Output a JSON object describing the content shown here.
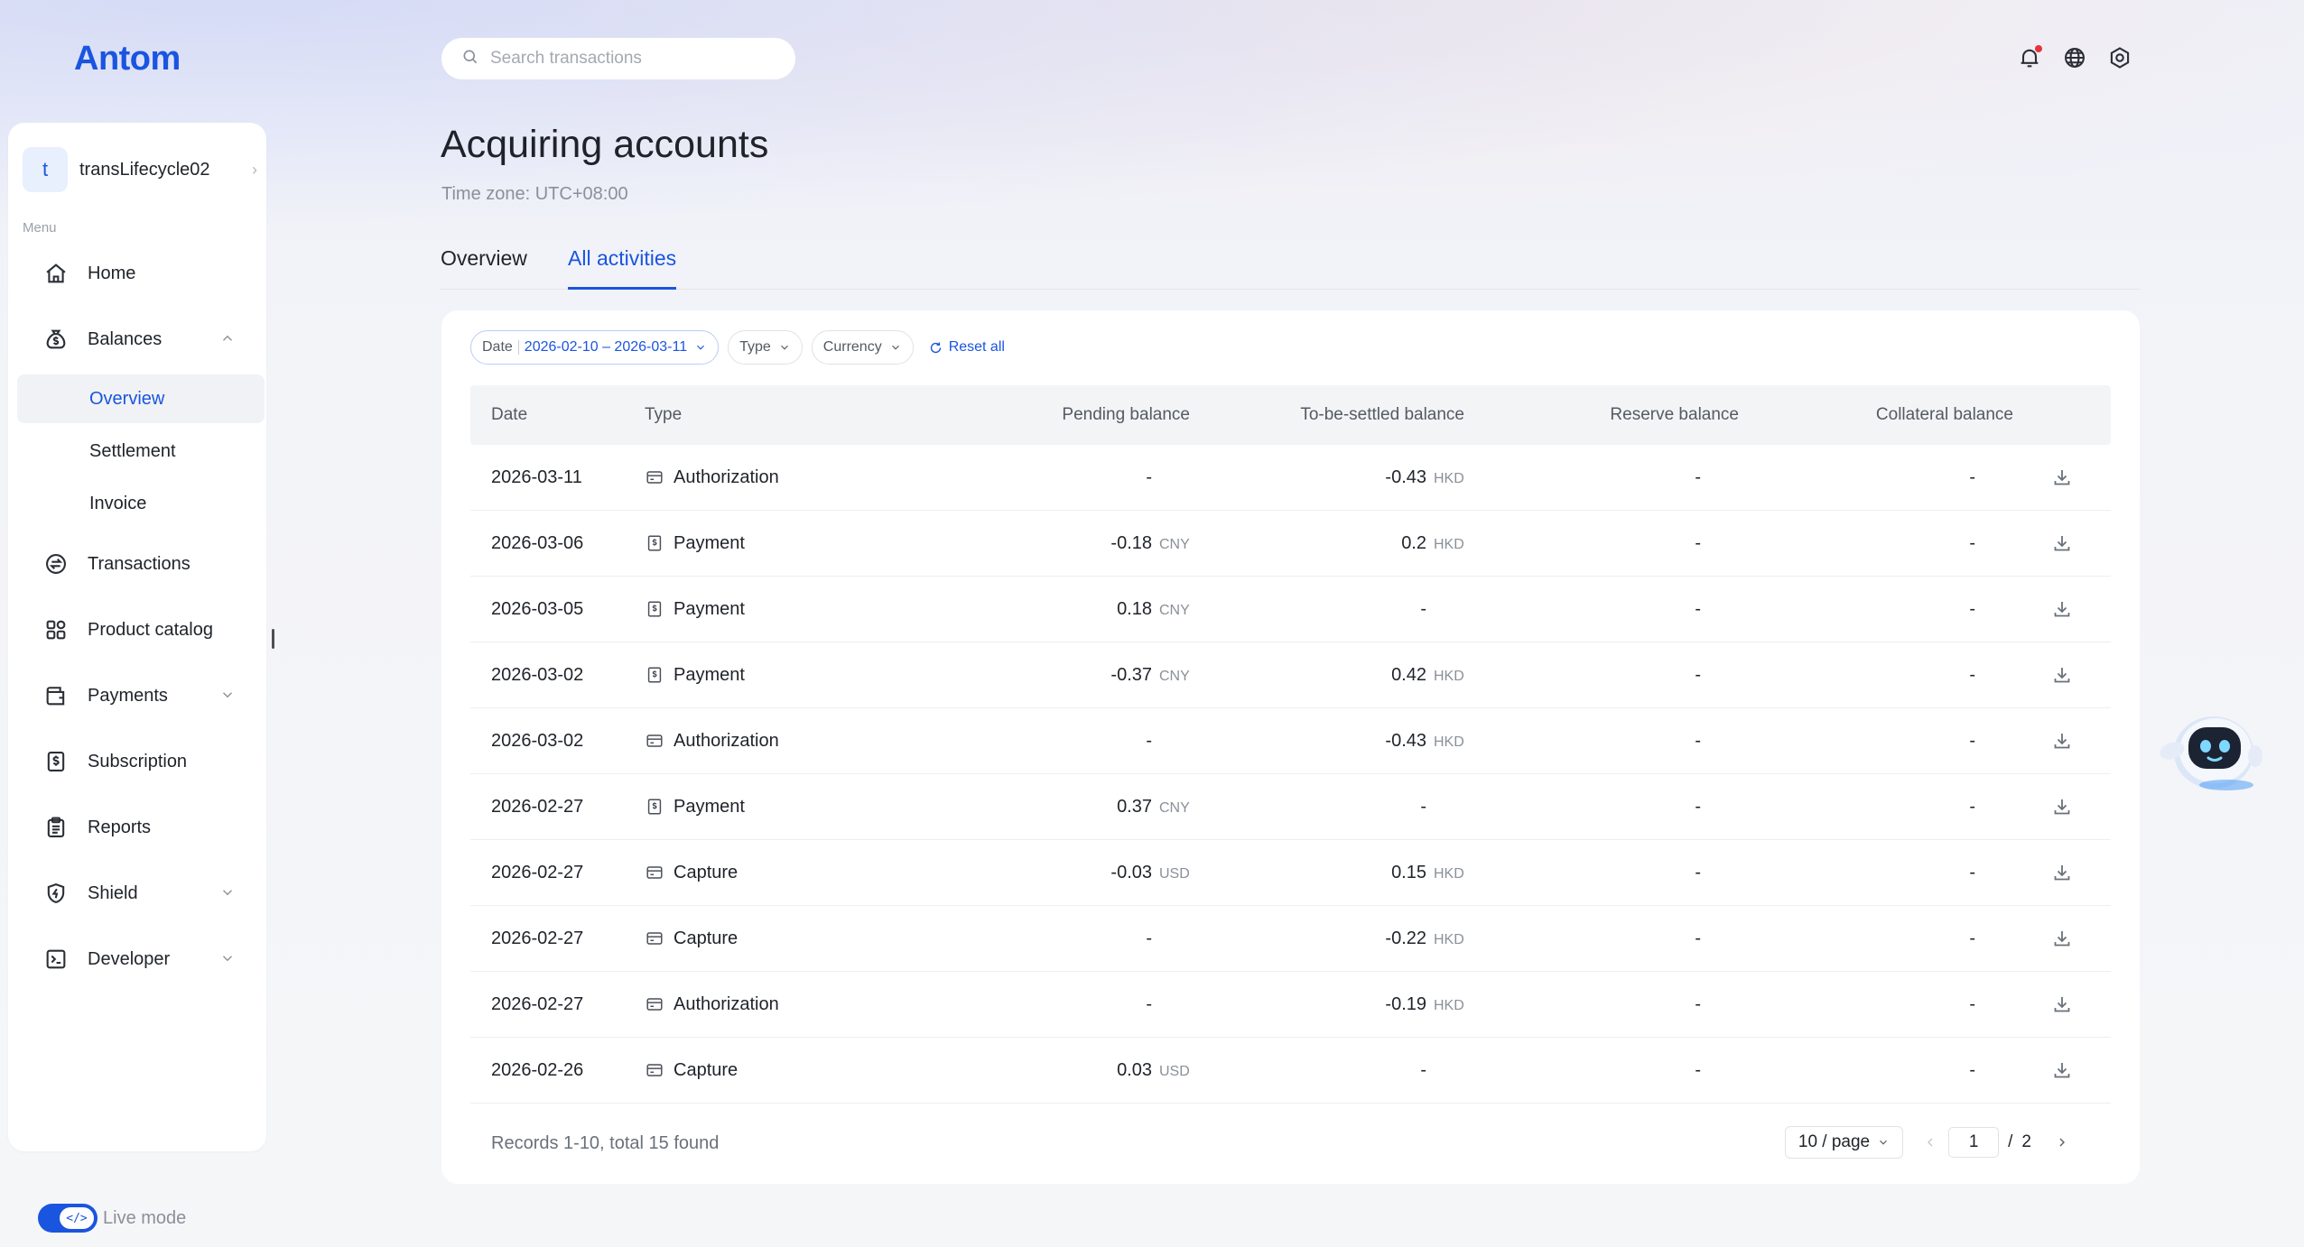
{
  "brand": {
    "logo_text": "Antom"
  },
  "header": {
    "search_placeholder": "Search transactions",
    "icons": [
      "notification-bell-icon",
      "globe-icon",
      "settings-gear-icon"
    ]
  },
  "sidebar": {
    "account_initial": "t",
    "account_name": "transLifecycle02",
    "menu_label": "Menu",
    "items": [
      {
        "label": "Home",
        "icon": "home-icon"
      },
      {
        "label": "Balances",
        "icon": "money-bag-icon",
        "expanded": true
      },
      {
        "label": "Transactions",
        "icon": "exchange-icon"
      },
      {
        "label": "Product catalog",
        "icon": "grid-icon"
      },
      {
        "label": "Payments",
        "icon": "wallet-icon",
        "expanded": false
      },
      {
        "label": "Subscription",
        "icon": "dollar-doc-icon"
      },
      {
        "label": "Reports",
        "icon": "clipboard-icon"
      },
      {
        "label": "Shield",
        "icon": "shield-icon",
        "expanded": false
      },
      {
        "label": "Developer",
        "icon": "terminal-icon",
        "expanded": false
      }
    ],
    "balances_sub": [
      {
        "label": "Overview",
        "active": true
      },
      {
        "label": "Settlement"
      },
      {
        "label": "Invoice"
      }
    ],
    "live_mode_label": "Live mode",
    "live_mode_on": true
  },
  "page": {
    "title": "Acquiring accounts",
    "timezone": "Time zone: UTC+08:00",
    "tabs": [
      {
        "label": "Overview",
        "active": false
      },
      {
        "label": "All activities",
        "active": true
      }
    ]
  },
  "filters": {
    "date_label": "Date",
    "date_value": "2026-02-10 – 2026-03-11",
    "type_label": "Type",
    "currency_label": "Currency",
    "reset_label": "Reset all"
  },
  "table": {
    "columns": [
      "Date",
      "Type",
      "Pending balance",
      "To-be-settled balance",
      "Reserve balance",
      "Collateral balance"
    ],
    "rows": [
      {
        "date": "2026-03-11",
        "type": "Authorization",
        "icon": "card-icon",
        "pending": "-",
        "pending_cur": "",
        "tbs": "-0.43",
        "tbs_cur": "HKD",
        "reserve": "-",
        "collateral": "-"
      },
      {
        "date": "2026-03-06",
        "type": "Payment",
        "icon": "receipt-icon",
        "pending": "-0.18",
        "pending_cur": "CNY",
        "tbs": "0.2",
        "tbs_cur": "HKD",
        "reserve": "-",
        "collateral": "-"
      },
      {
        "date": "2026-03-05",
        "type": "Payment",
        "icon": "receipt-icon",
        "pending": "0.18",
        "pending_cur": "CNY",
        "tbs": "-",
        "tbs_cur": "",
        "reserve": "-",
        "collateral": "-"
      },
      {
        "date": "2026-03-02",
        "type": "Payment",
        "icon": "receipt-icon",
        "pending": "-0.37",
        "pending_cur": "CNY",
        "tbs": "0.42",
        "tbs_cur": "HKD",
        "reserve": "-",
        "collateral": "-"
      },
      {
        "date": "2026-03-02",
        "type": "Authorization",
        "icon": "card-icon",
        "pending": "-",
        "pending_cur": "",
        "tbs": "-0.43",
        "tbs_cur": "HKD",
        "reserve": "-",
        "collateral": "-"
      },
      {
        "date": "2026-02-27",
        "type": "Payment",
        "icon": "receipt-icon",
        "pending": "0.37",
        "pending_cur": "CNY",
        "tbs": "-",
        "tbs_cur": "",
        "reserve": "-",
        "collateral": "-"
      },
      {
        "date": "2026-02-27",
        "type": "Capture",
        "icon": "card-icon",
        "pending": "-0.03",
        "pending_cur": "USD",
        "tbs": "0.15",
        "tbs_cur": "HKD",
        "reserve": "-",
        "collateral": "-"
      },
      {
        "date": "2026-02-27",
        "type": "Capture",
        "icon": "card-icon",
        "pending": "-",
        "pending_cur": "",
        "tbs": "-0.22",
        "tbs_cur": "HKD",
        "reserve": "-",
        "collateral": "-"
      },
      {
        "date": "2026-02-27",
        "type": "Authorization",
        "icon": "card-icon",
        "pending": "-",
        "pending_cur": "",
        "tbs": "-0.19",
        "tbs_cur": "HKD",
        "reserve": "-",
        "collateral": "-"
      },
      {
        "date": "2026-02-26",
        "type": "Capture",
        "icon": "card-icon",
        "pending": "0.03",
        "pending_cur": "USD",
        "tbs": "-",
        "tbs_cur": "",
        "reserve": "-",
        "collateral": "-"
      }
    ]
  },
  "pagination": {
    "records_text": "Records 1-10, total 15 found",
    "page_size": "10 / page",
    "current_page": "1",
    "slash": "/",
    "total_pages": "2"
  },
  "assistant": {
    "icon": "robot-assistant-icon"
  },
  "colors": {
    "accent": "#1a55e0",
    "alert": "#e8323c"
  }
}
